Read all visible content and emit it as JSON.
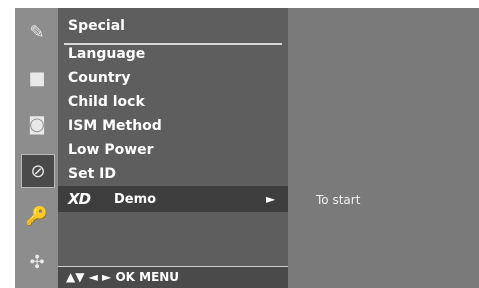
{
  "icons": [
    {
      "name": "picture-settings-icon",
      "glyph": "✎"
    },
    {
      "name": "screen-icon",
      "glyph": "■"
    },
    {
      "name": "audio-icon",
      "glyph": "◙"
    },
    {
      "name": "time-icon",
      "glyph": "⊘"
    },
    {
      "name": "option-icon",
      "glyph": "🔑"
    },
    {
      "name": "setup-icon",
      "glyph": "✣"
    }
  ],
  "menu": {
    "title": "Special",
    "items": [
      "Language",
      "Country",
      "Child lock",
      "ISM Method",
      "Low Power",
      "Set ID"
    ],
    "highlight": {
      "logo": "XD",
      "label": "Demo",
      "arrow": "►"
    },
    "help": "▲▼  ◄ ►  OK   MENU"
  },
  "right_panel": {
    "text": "To start"
  }
}
